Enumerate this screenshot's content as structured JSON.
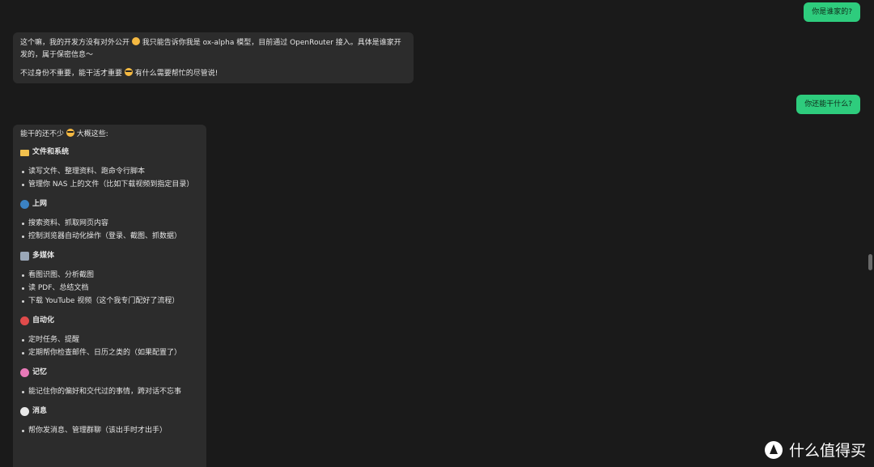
{
  "messages": {
    "user1": "你是谁家的?",
    "bot1_line1_part1": "这个嘛，我的开发方没有对外公开 ",
    "bot1_line1_part2": " 我只能告诉你我是 ox-alpha 模型，目前通过 OpenRouter 接入。具体是谁家开发的，属于保密信息～",
    "bot1_line2_part1": "不过身份不重要，能干活才重要 ",
    "bot1_line2_part2": " 有什么需要帮忙的尽管说!",
    "user2": "你还能干什么?",
    "bot2_intro_part1": "能干的还不少 ",
    "bot2_intro_part2": " 大概这些:"
  },
  "sections": [
    {
      "icon": "folder-icon",
      "title": "文件和系统",
      "items": [
        "读写文件、整理资料、跑命令行脚本",
        "管理你 NAS 上的文件（比如下载视频到指定目录）"
      ]
    },
    {
      "icon": "globe-icon",
      "title": "上网",
      "items": [
        "搜索资料、抓取网页内容",
        "控制浏览器自动化操作（登录、截图、抓数据）"
      ]
    },
    {
      "icon": "media-icon",
      "title": "多媒体",
      "items": [
        "看图识图、分析截图",
        "读 PDF、总结文档",
        "下载 YouTube 视频（这个我专门配好了流程）"
      ]
    },
    {
      "icon": "alarm-clock-icon",
      "title": "自动化",
      "items": [
        "定时任务、提醒",
        "定期帮你检查邮件、日历之类的（如果配置了）"
      ]
    },
    {
      "icon": "brain-icon",
      "title": "记忆",
      "items": [
        "能记住你的偏好和交代过的事情，跨对话不忘事"
      ]
    },
    {
      "icon": "speech-bubble-icon",
      "title": "消息",
      "items": [
        "帮你发消息、管理群聊（该出手时才出手）"
      ]
    }
  ],
  "watermark": {
    "text": "什么值得买",
    "logo_icon": "smzdm-logo-icon"
  }
}
